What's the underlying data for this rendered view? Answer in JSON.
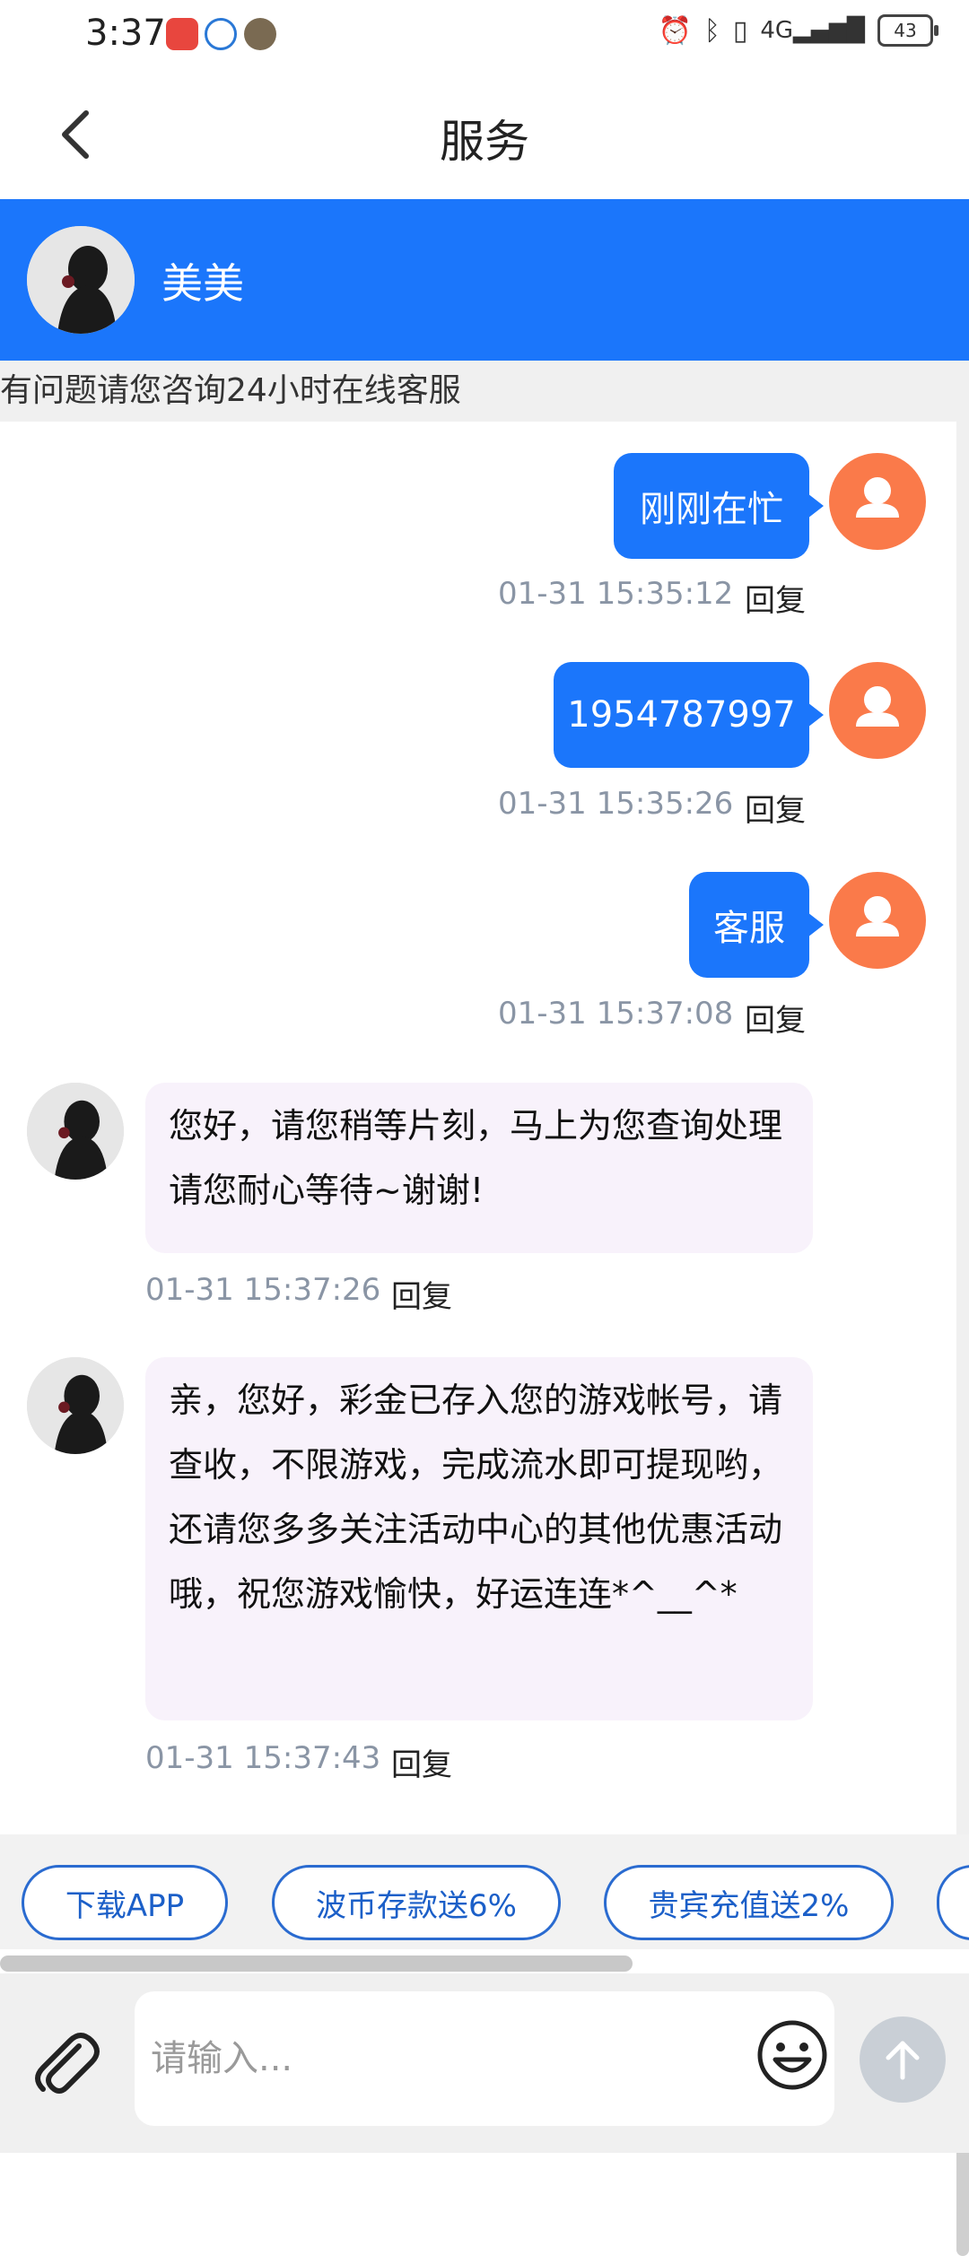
{
  "status_bar": {
    "time": "3:37",
    "battery": "43"
  },
  "nav": {
    "title": "服务"
  },
  "agent": {
    "name": "美美"
  },
  "notice": "有问题请您咨询24小时在线客服",
  "messages": [
    {
      "from": "user",
      "text": "刚刚在忙",
      "time": "01-31 15:35:12",
      "reply": "回复"
    },
    {
      "from": "user",
      "text": "1954787997",
      "time": "01-31 15:35:26",
      "reply": "回复"
    },
    {
      "from": "user",
      "text": "客服",
      "time": "01-31 15:37:08",
      "reply": "回复"
    },
    {
      "from": "agent",
      "text": "您好，请您稍等片刻，马上为您查询处理请您耐心等待~谢谢!",
      "time": "01-31 15:37:26",
      "reply": "回复"
    },
    {
      "from": "agent",
      "text": "亲，您好，彩金已存入您的游戏帐号，请查收，不限游戏，完成流水即可提现哟，还请您多多关注活动中心的其他优惠活动哦，祝您游戏愉快，好运连连*^__^*",
      "time": "01-31 15:37:43",
      "reply": "回复"
    }
  ],
  "quick_actions": [
    "下载APP",
    "波币存款送6%",
    "贵宾充值送2%"
  ],
  "input": {
    "placeholder": "请输入..."
  },
  "colors": {
    "primary": "#1b76fb",
    "user_avatar": "#fa7a4a",
    "agent_bubble": "#f8f2fb"
  },
  "icons": [
    "back-icon",
    "user-icon",
    "paperclip-icon",
    "emoji-icon",
    "arrow-up-icon"
  ]
}
